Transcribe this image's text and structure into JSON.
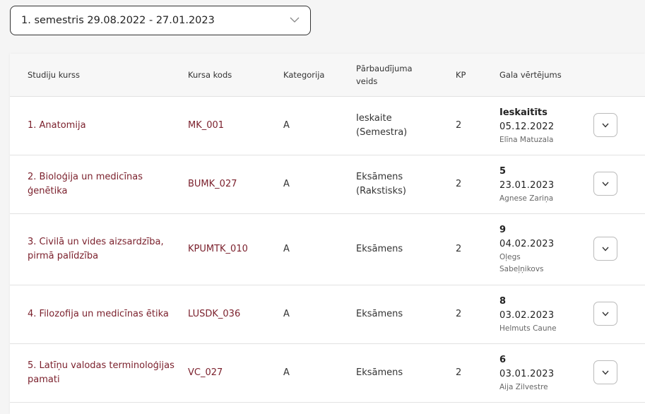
{
  "semester_select": {
    "value": "1. semestris 29.08.2022 - 27.01.2023",
    "icon": "chevron-down-icon"
  },
  "table": {
    "headers": {
      "course": "Studiju kurss",
      "code": "Kursa kods",
      "category": "Kategorija",
      "exam_type": "Pārbaudījuma veids",
      "kp": "KP",
      "final_grade": "Gala vērtējums"
    },
    "rows": [
      {
        "course": "1. Anatomija",
        "code": "MK_001",
        "category": "A",
        "exam_type": "Ieskaite (Semestra)",
        "kp": "2",
        "grade": "Ieskaitīts",
        "date": "05.12.2022",
        "teacher": "Elīna Matuzala"
      },
      {
        "course": "2. Bioloģija un medicīnas ģenētika",
        "code": "BUMK_027",
        "category": "A",
        "exam_type": "Eksāmens (Rakstisks)",
        "kp": "2",
        "grade": "5",
        "date": "23.01.2023",
        "teacher": "Agnese Zariņa"
      },
      {
        "course": "3. Civilā un vides aizsardzība, pirmā palīdzība",
        "code": "KPUMTK_010",
        "category": "A",
        "exam_type": "Eksāmens",
        "kp": "2",
        "grade": "9",
        "date": "04.02.2023",
        "teacher": "Oļegs Sabeļņikovs"
      },
      {
        "course": "4. Filozofija un medicīnas ētika",
        "code": "LUSDK_036",
        "category": "A",
        "exam_type": "Eksāmens",
        "kp": "2",
        "grade": "8",
        "date": "03.02.2023",
        "teacher": "Helmuts Caune"
      },
      {
        "course": "5. Latīņu valodas terminoloģijas pamati",
        "code": "VC_027",
        "category": "A",
        "exam_type": "Eksāmens",
        "kp": "2",
        "grade": "6",
        "date": "03.01.2023",
        "teacher": "Aija Zilvestre"
      }
    ]
  }
}
